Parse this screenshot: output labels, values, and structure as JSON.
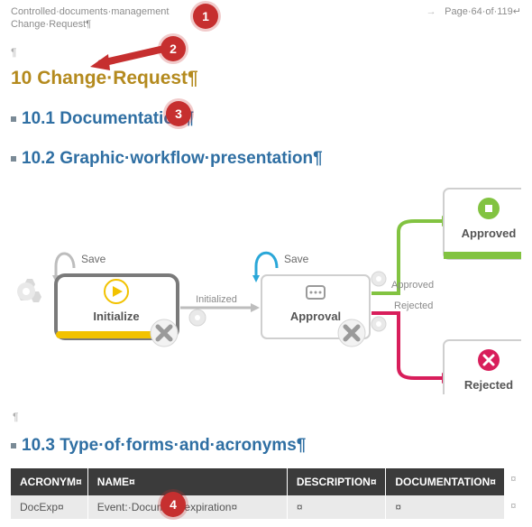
{
  "header": {
    "left": "Controlled·documents·management",
    "arrow": "→",
    "right": "Page·64·of·119↵",
    "sub": "Change·Request¶"
  },
  "paragraph_marks": {
    "p1": "¶",
    "p2": "¶"
  },
  "headings": {
    "h1": "10 Change·Request¶",
    "h2_1": "10.1 Documentation¶",
    "h2_2": "10.2 Graphic·workflow·presentation¶",
    "h2_3": "10.3 Type·of·forms·and·acronyms¶"
  },
  "workflow": {
    "nodes": {
      "initialize": {
        "label": "Initialize",
        "save": "Save"
      },
      "approval": {
        "label": "Approval",
        "save": "Save"
      },
      "approved": {
        "label": "Approved"
      },
      "rejected": {
        "label": "Rejected"
      }
    },
    "edges": {
      "initialized": "Initialized",
      "approved": "Approved",
      "rejected": "Rejected"
    }
  },
  "table": {
    "headers": {
      "c1": "ACRONYM¤",
      "c2": "NAME¤",
      "c3": "DESCRIPTION¤",
      "c4": "DOCUMENTATION¤"
    },
    "row1": {
      "c1": "DocExp¤",
      "c2": "Event:·Document·expiration¤",
      "c3": "¤",
      "c4": "¤"
    },
    "row_end_mark": "¤"
  },
  "callouts": {
    "n1": "1",
    "n2": "2",
    "n3": "3",
    "n4": "4"
  }
}
